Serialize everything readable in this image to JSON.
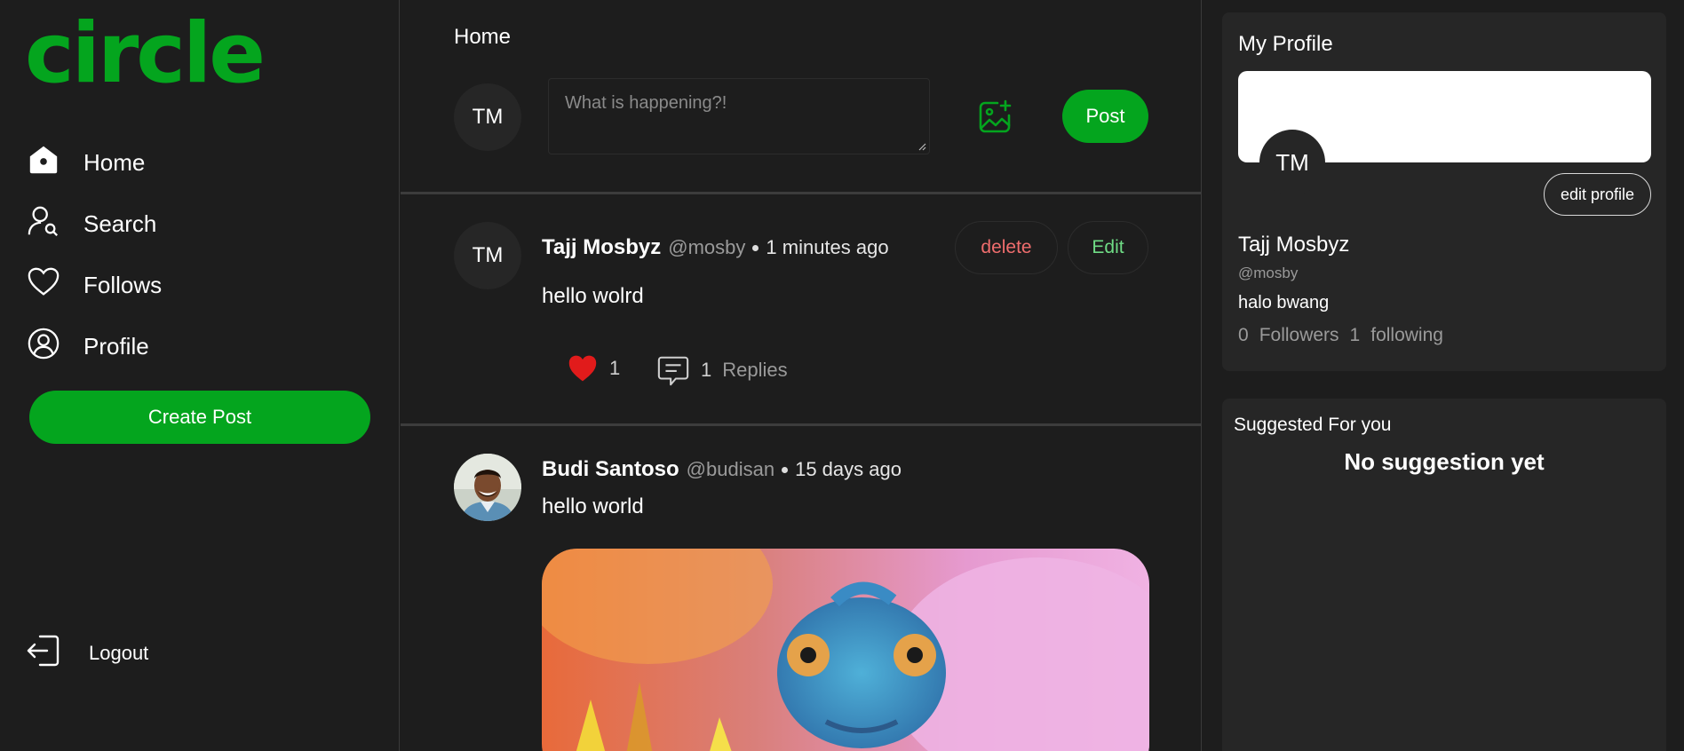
{
  "app": {
    "logo": "circle",
    "accent": "#04a51e"
  },
  "sidebar": {
    "items": [
      {
        "label": "Home",
        "icon": "home-icon"
      },
      {
        "label": "Search",
        "icon": "search-user-icon"
      },
      {
        "label": "Follows",
        "icon": "heart-icon"
      },
      {
        "label": "Profile",
        "icon": "profile-icon"
      }
    ],
    "create_post": "Create Post",
    "logout": "Logout"
  },
  "main": {
    "title": "Home",
    "compose": {
      "avatar_initials": "TM",
      "placeholder": "What is happening?!",
      "post_button": "Post"
    },
    "posts": [
      {
        "avatar_initials": "TM",
        "name": "Tajj Mosbyz",
        "handle": "@mosby",
        "time": "1 minutes ago",
        "body": "hello wolrd",
        "delete_label": "delete",
        "edit_label": "Edit",
        "likes": "1",
        "replies_count": "1",
        "replies_label": "Replies"
      },
      {
        "name": "Budi Santoso",
        "handle": "@budisan",
        "time": "15 days ago",
        "body": "hello world"
      }
    ]
  },
  "profile_card": {
    "title": "My Profile",
    "avatar_initials": "TM",
    "edit_button": "edit profile",
    "name": "Tajj Mosbyz",
    "handle": "@mosby",
    "bio": "halo bwang",
    "followers_count": "0",
    "followers_label": "Followers",
    "following_count": "1",
    "following_label": "following"
  },
  "suggestions": {
    "title": "Suggested For you",
    "empty": "No suggestion yet"
  }
}
